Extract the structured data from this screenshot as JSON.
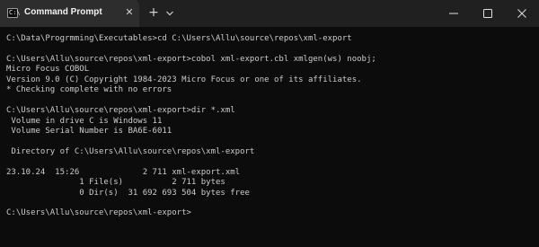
{
  "tab": {
    "title": "Command Prompt",
    "icon": "command-prompt-icon",
    "icon_glyph": "C:\\"
  },
  "titlebar": {
    "close_tab_glyph": "✕",
    "new_tab_glyph": "+",
    "dropdown_icon": "chevron-down-icon",
    "minimize_icon": "minimize-icon",
    "maximize_icon": "maximize-icon",
    "close_icon": "close-icon"
  },
  "console": {
    "lines": [
      "C:\\Data\\Progrmming\\Executables>cd C:\\Users\\Allu\\source\\repos\\xml-export",
      "",
      "C:\\Users\\Allu\\source\\repos\\xml-export>cobol xml-export.cbl xmlgen(ws) noobj;",
      "Micro Focus COBOL",
      "Version 9.0 (C) Copyright 1984-2023 Micro Focus or one of its affiliates.",
      "* Checking complete with no errors",
      "",
      "C:\\Users\\Allu\\source\\repos\\xml-export>dir *.xml",
      " Volume in drive C is Windows 11",
      " Volume Serial Number is BA6E-6011",
      "",
      " Directory of C:\\Users\\Allu\\source\\repos\\xml-export",
      "",
      "23.10.24  15:26             2 711 xml-export.xml",
      "               1 File(s)          2 711 bytes",
      "               0 Dir(s)  31 692 693 504 bytes free",
      "",
      "C:\\Users\\Allu\\source\\repos\\xml-export>"
    ]
  },
  "colors": {
    "background": "#0c0c0c",
    "text": "#cccccc",
    "tabbar": "#202020",
    "active_tab": "#2d2d2d"
  }
}
